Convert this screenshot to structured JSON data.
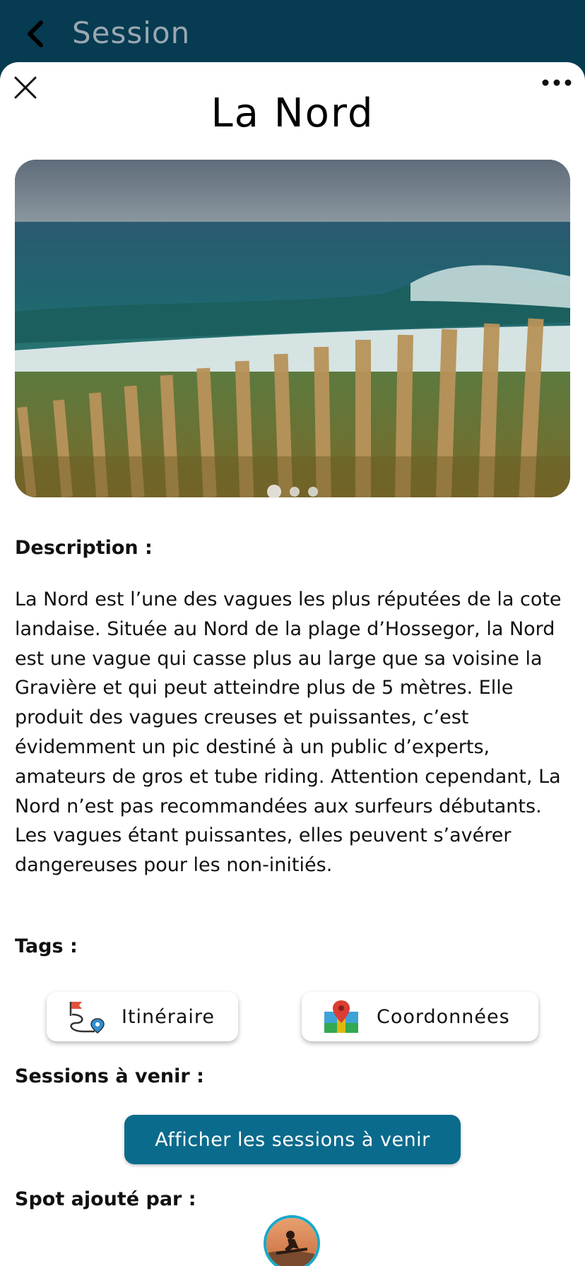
{
  "header": {
    "back_icon": "chevron-left-icon",
    "title": "Session"
  },
  "sheet": {
    "close_icon": "close-icon",
    "more_icon": "more-horizontal-icon",
    "title": "La Nord"
  },
  "carousel": {
    "image_alt": "Surf wave at La Nord beach behind wooden fence",
    "slide_count": 3,
    "active_slide": 1
  },
  "description": {
    "label": "Description :",
    "text": "La Nord est l’une des vagues les plus réputées de la cote landaise. Située au Nord de la plage d’Hossegor, la Nord est une vague qui casse plus au large que sa voisine la Gravière et qui peut atteindre plus de 5 mètres. Elle produit des vagues creuses et puissantes, c’est évidemment un pic destiné à un public d’experts, amateurs de gros et tube riding. Attention cependant, La Nord n’est pas recommandées aux surfeurs débutants. Les vagues étant puissantes, elles peuvent s’avérer dangereuses pour les non-initiés."
  },
  "tags": {
    "label": "Tags :",
    "items": [
      {
        "label": "Itinéraire",
        "icon": "route-icon"
      },
      {
        "label": "Coordonnées",
        "icon": "map-pin-icon"
      }
    ]
  },
  "sessions": {
    "label": "Sessions à venir :",
    "button_label": "Afficher les sessions à venir"
  },
  "added_by": {
    "label": "Spot ajouté par :"
  },
  "colors": {
    "header_bg": "#063b52",
    "primary_button": "#0b6b8c",
    "avatar_ring": "#17a9c9"
  }
}
